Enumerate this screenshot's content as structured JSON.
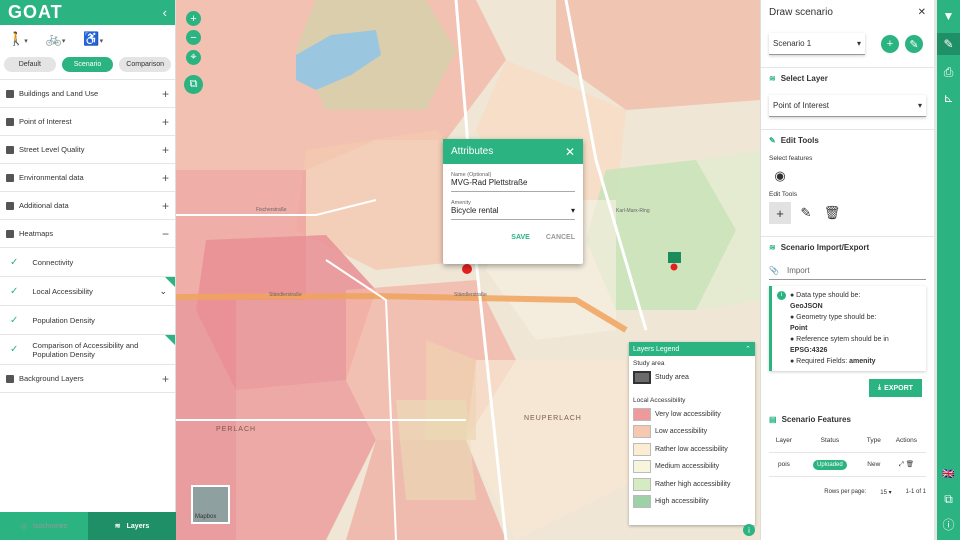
{
  "app": {
    "logo": "GOAT"
  },
  "left_panel": {
    "collapse_icon": "chevron-left-icon",
    "modes": [
      "walking-icon",
      "bicycle-icon",
      "wheelchair-icon"
    ],
    "calc_tabs": [
      "Default",
      "Scenario",
      "Comparison"
    ],
    "layers": [
      {
        "label": "Buildings and Land Use"
      },
      {
        "label": "Point of Interest"
      },
      {
        "label": "Street Level Quality"
      },
      {
        "label": "Environmental data"
      },
      {
        "label": "Additional data"
      },
      {
        "label": "Heatmaps"
      }
    ],
    "heatmaps": [
      {
        "label": "Connectivity"
      },
      {
        "label": "Local Accessibility"
      },
      {
        "label": "Population Density"
      },
      {
        "label": "Comparison of Accessibility and Population Density"
      }
    ],
    "background_layers": "Background Layers",
    "bottom_nav": {
      "isochrones": "Isochrones",
      "layers": "Layers"
    }
  },
  "map": {
    "zoom_in": "+",
    "zoom_out": "−",
    "popup": {
      "title": "Attributes",
      "name_label": "Name (Optional)",
      "name_value": "MVG-Rad Plettstraße",
      "amenity_label": "Amenity",
      "amenity_value": "Bicycle rental",
      "save": "SAVE",
      "cancel": "CANCEL"
    },
    "legend": {
      "title": "Layers Legend",
      "study_area_group": "Study area",
      "study_area_item": "Study area",
      "accessibility_group": "Local Accessibility",
      "items": [
        {
          "label": "Very low accessibility",
          "color": "#ef9a9a"
        },
        {
          "label": "Low accessibility",
          "color": "#f7c8b0"
        },
        {
          "label": "Rather low accessibility",
          "color": "#fbecd4"
        },
        {
          "label": "Medium accessibility",
          "color": "#f7f5dc"
        },
        {
          "label": "Rather high accessibility",
          "color": "#d5ebc2"
        },
        {
          "label": "High accessibility",
          "color": "#9fd1a8"
        }
      ]
    },
    "mapbox_label": "Mapbox",
    "place_labels": [
      "PERLACH",
      "NEUPERLACH",
      "Ständlerstraße",
      "Adolf-Kolping-Straße",
      "Fischerstraße",
      "Karl-Marx-Ring"
    ],
    "info": "i"
  },
  "right_panel": {
    "title": "Draw scenario",
    "scenario_select": "Scenario 1",
    "select_layer_title": "Select Layer",
    "layer_select": "Point of Interest",
    "edit_tools_title": "Edit Tools",
    "select_features_label": "Select features",
    "edit_tools_label": "Edit Tools",
    "import_export_title": "Scenario Import/Export",
    "import_placeholder": "Import",
    "info_lines": [
      "● Data type should be:",
      "GeoJSON",
      "● Geometry type should be:",
      "Point",
      "● Reference sytem should be in",
      "EPSG:4326",
      "● Required Fields:"
    ],
    "required_field": "amenity",
    "export_label": "EXPORT",
    "features_title": "Scenario Features",
    "table_headers": [
      "Layer",
      "Status",
      "Type",
      "Actions"
    ],
    "table_rows": [
      {
        "layer": "pois",
        "status": "Uploaded",
        "type": "New"
      }
    ],
    "rows_per_page_label": "Rows per page:",
    "rows_per_page": "15",
    "page_range": "1-1 of 1"
  },
  "right_rail": {
    "icons": [
      "filter-icon",
      "edit-icon",
      "print-icon",
      "measure-icon",
      "uk-flag-icon",
      "map-icon",
      "info-icon"
    ]
  }
}
